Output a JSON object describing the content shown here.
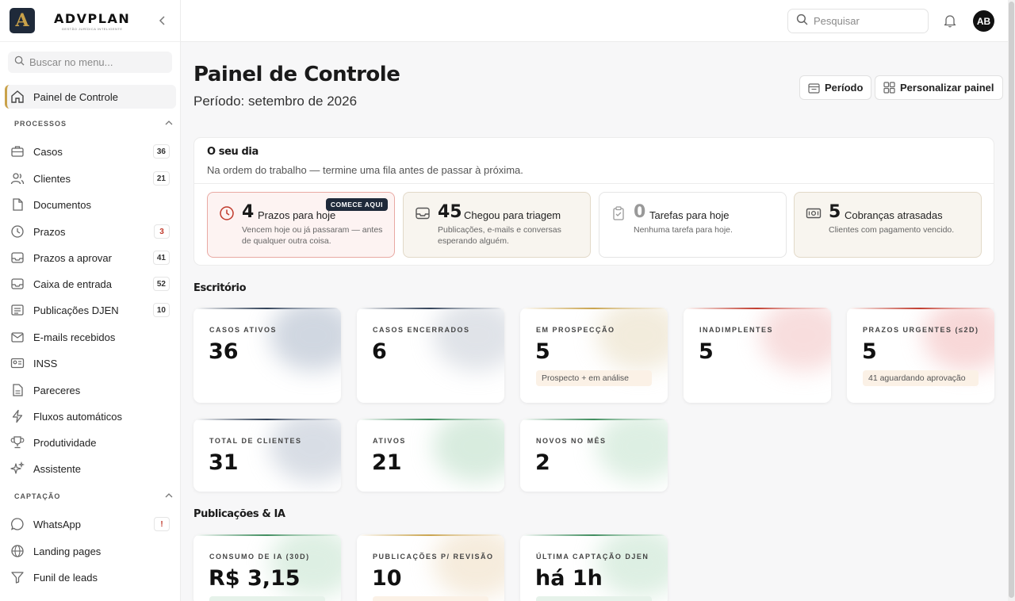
{
  "brand": {
    "logo_letter": "A",
    "name": "ADVPLAN",
    "tagline": "GESTÃO JURÍDICA INTELIGENTE"
  },
  "sidebar": {
    "search_placeholder": "Buscar no menu...",
    "dashboard": "Painel de Controle",
    "section_processos": "PROCESSOS",
    "section_captacao": "CAPTAÇÃO",
    "items": [
      {
        "label": "Casos",
        "badge": "36"
      },
      {
        "label": "Clientes",
        "badge": "21"
      },
      {
        "label": "Documentos",
        "badge": ""
      },
      {
        "label": "Prazos",
        "badge": "3"
      },
      {
        "label": "Prazos a aprovar",
        "badge": "41"
      },
      {
        "label": "Caixa de entrada",
        "badge": "52"
      },
      {
        "label": "Publicações DJEN",
        "badge": "10"
      },
      {
        "label": "E-mails recebidos",
        "badge": ""
      },
      {
        "label": "INSS",
        "badge": ""
      },
      {
        "label": "Pareceres",
        "badge": ""
      },
      {
        "label": "Fluxos automáticos",
        "badge": ""
      },
      {
        "label": "Produtividade",
        "badge": ""
      },
      {
        "label": "Assistente",
        "badge": ""
      }
    ],
    "captacao_items": [
      {
        "label": "WhatsApp",
        "badge": "!"
      },
      {
        "label": "Landing pages",
        "badge": ""
      },
      {
        "label": "Funil de leads",
        "badge": ""
      }
    ]
  },
  "topbar": {
    "search_placeholder": "Pesquisar",
    "avatar": "AB"
  },
  "header": {
    "title": "Painel de Controle",
    "subtitle": "Período: setembro de 2026",
    "period_button": "Período",
    "customize_button": "Personalizar painel"
  },
  "day": {
    "title": "O seu dia",
    "subtitle": "Na ordem do trabalho — termine uma fila antes de passar à próxima.",
    "start_badge": "COMECE AQUI",
    "queues": [
      {
        "count": "4",
        "label": "Prazos para hoje",
        "desc": "Vencem hoje ou já passaram — antes de qualquer outra coisa."
      },
      {
        "count": "45",
        "label": "Chegou para triagem",
        "desc": "Publicações, e-mails e conversas esperando alguém."
      },
      {
        "count": "0",
        "label": "Tarefas para hoje",
        "desc": "Nenhuma tarefa para hoje."
      },
      {
        "count": "5",
        "label": "Cobranças atrasadas",
        "desc": "Clientes com pagamento vencido."
      }
    ]
  },
  "escritorio": {
    "title": "Escritório",
    "kpis": [
      {
        "label": "CASOS ATIVOS",
        "value": "36",
        "chip": ""
      },
      {
        "label": "CASOS ENCERRADOS",
        "value": "6",
        "chip": ""
      },
      {
        "label": "EM PROSPECÇÃO",
        "value": "5",
        "chip": "Prospecto + em análise"
      },
      {
        "label": "INADIMPLENTES",
        "value": "5",
        "chip": ""
      },
      {
        "label": "PRAZOS URGENTES (≤2D)",
        "value": "5",
        "chip": "41 aguardando aprovação"
      },
      {
        "label": "TOTAL DE CLIENTES",
        "value": "31",
        "chip": ""
      },
      {
        "label": "ATIVOS",
        "value": "21",
        "chip": ""
      },
      {
        "label": "NOVOS NO MÊS",
        "value": "2",
        "chip": ""
      }
    ]
  },
  "publicacoes": {
    "title": "Publicações & IA",
    "kpis": [
      {
        "label": "CONSUMO DE IA (30D)",
        "value": "R$ 3,15"
      },
      {
        "label": "PUBLICAÇÕES P/ REVISÃO",
        "value": "10"
      },
      {
        "label": "ÚLTIMA CAPTAÇÃO DJEN",
        "value": "há 1h"
      }
    ]
  },
  "colors": {
    "accent_gold": "#c9a24a",
    "navy": "#1f2a3a",
    "urgent_red": "#e9a9a3",
    "warm_sand": "#e2d9c8"
  }
}
